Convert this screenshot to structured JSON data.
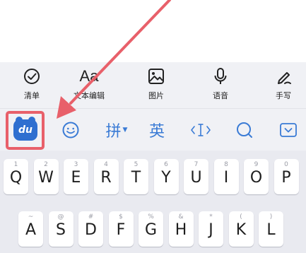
{
  "toolbar": {
    "items": [
      {
        "label": "清单",
        "icon": "checklist-icon"
      },
      {
        "label": "文本编辑",
        "icon": "text-edit-icon",
        "glyph": "Aa"
      },
      {
        "label": "图片",
        "icon": "image-icon"
      },
      {
        "label": "语音",
        "icon": "microphone-icon"
      },
      {
        "label": "手写",
        "icon": "handwriting-icon"
      }
    ]
  },
  "ime_bar": {
    "logo_text": "du",
    "logo_icon": "baidu-ime-logo-icon",
    "emoji_icon": "emoji-icon",
    "pinyin_label": "拼",
    "english_label": "英",
    "cursor_icon": "cursor-move-icon",
    "search_icon": "search-icon",
    "collapse_icon": "collapse-keyboard-icon"
  },
  "keyboard": {
    "row1": [
      {
        "letter": "Q",
        "hint": "1"
      },
      {
        "letter": "W",
        "hint": "2"
      },
      {
        "letter": "E",
        "hint": "3"
      },
      {
        "letter": "R",
        "hint": "4"
      },
      {
        "letter": "T",
        "hint": "5"
      },
      {
        "letter": "Y",
        "hint": "6"
      },
      {
        "letter": "U",
        "hint": "7"
      },
      {
        "letter": "I",
        "hint": "8"
      },
      {
        "letter": "O",
        "hint": "9"
      },
      {
        "letter": "P",
        "hint": "0"
      }
    ],
    "row2": [
      {
        "letter": "A",
        "hint": "~"
      },
      {
        "letter": "S",
        "hint": "@"
      },
      {
        "letter": "D",
        "hint": "#"
      },
      {
        "letter": "F",
        "hint": "$"
      },
      {
        "letter": "G",
        "hint": "%"
      },
      {
        "letter": "H",
        "hint": "&"
      },
      {
        "letter": "J",
        "hint": "*"
      },
      {
        "letter": "K",
        "hint": "("
      },
      {
        "letter": "L",
        "hint": ")"
      }
    ]
  },
  "colors": {
    "accent": "#3a7bd5",
    "logo": "#2f6fd0",
    "annotation": "#e8606a",
    "bar_background": "#f0f1f5",
    "keyboard_background": "#e9eaf0"
  }
}
